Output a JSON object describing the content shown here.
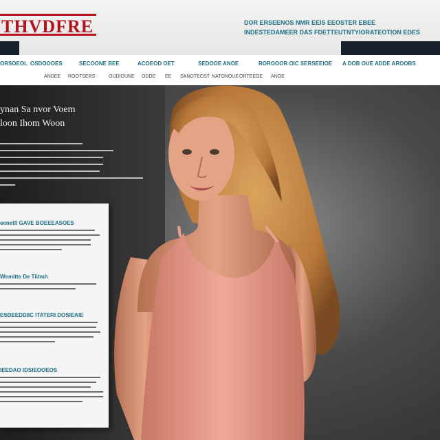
{
  "header": {
    "logo_text": "THVDFRE",
    "utility_lines": [
      "DOR ERSEENOS   NMR  EEIS EEOSTER EBEE",
      "INDESTEDAMEER DAS   FDETTEUTNTYIORATEOTION EDES"
    ]
  },
  "nav": {
    "primary": [
      "ORSOEOL",
      "OSDOOOES",
      "SECOONE BEE",
      "ACOEOD OET",
      "SEDOOE ANOE",
      "ROROOOR OIC SERSEEIOE",
      "A DOB OUE ADDE AROOBS"
    ],
    "secondary": [
      "ANDEE",
      "ROOTSERS",
      "OUDIOUNE",
      "ODDE",
      "EE",
      "SANOTEOST",
      "NATONOUE",
      "ORTEEOE",
      "ANOE"
    ]
  },
  "hero": {
    "headline": [
      "ynan Sa nvor Voem",
      "loon Ihom Woon"
    ]
  },
  "card": {
    "sections": [
      {
        "title": "eenetll GAVE BOEEEASOES"
      },
      {
        "title": "Wemitte De Tiitmh"
      },
      {
        "title": "ESDEEDDIIC ITATERI DOSIEAIE"
      },
      {
        "title": "IEEDAO IDSIEOOEOS"
      }
    ]
  },
  "colors": {
    "brand_red": "#b5121b",
    "accent_teal": "#1d6f86",
    "dark_bar": "#15202a"
  }
}
